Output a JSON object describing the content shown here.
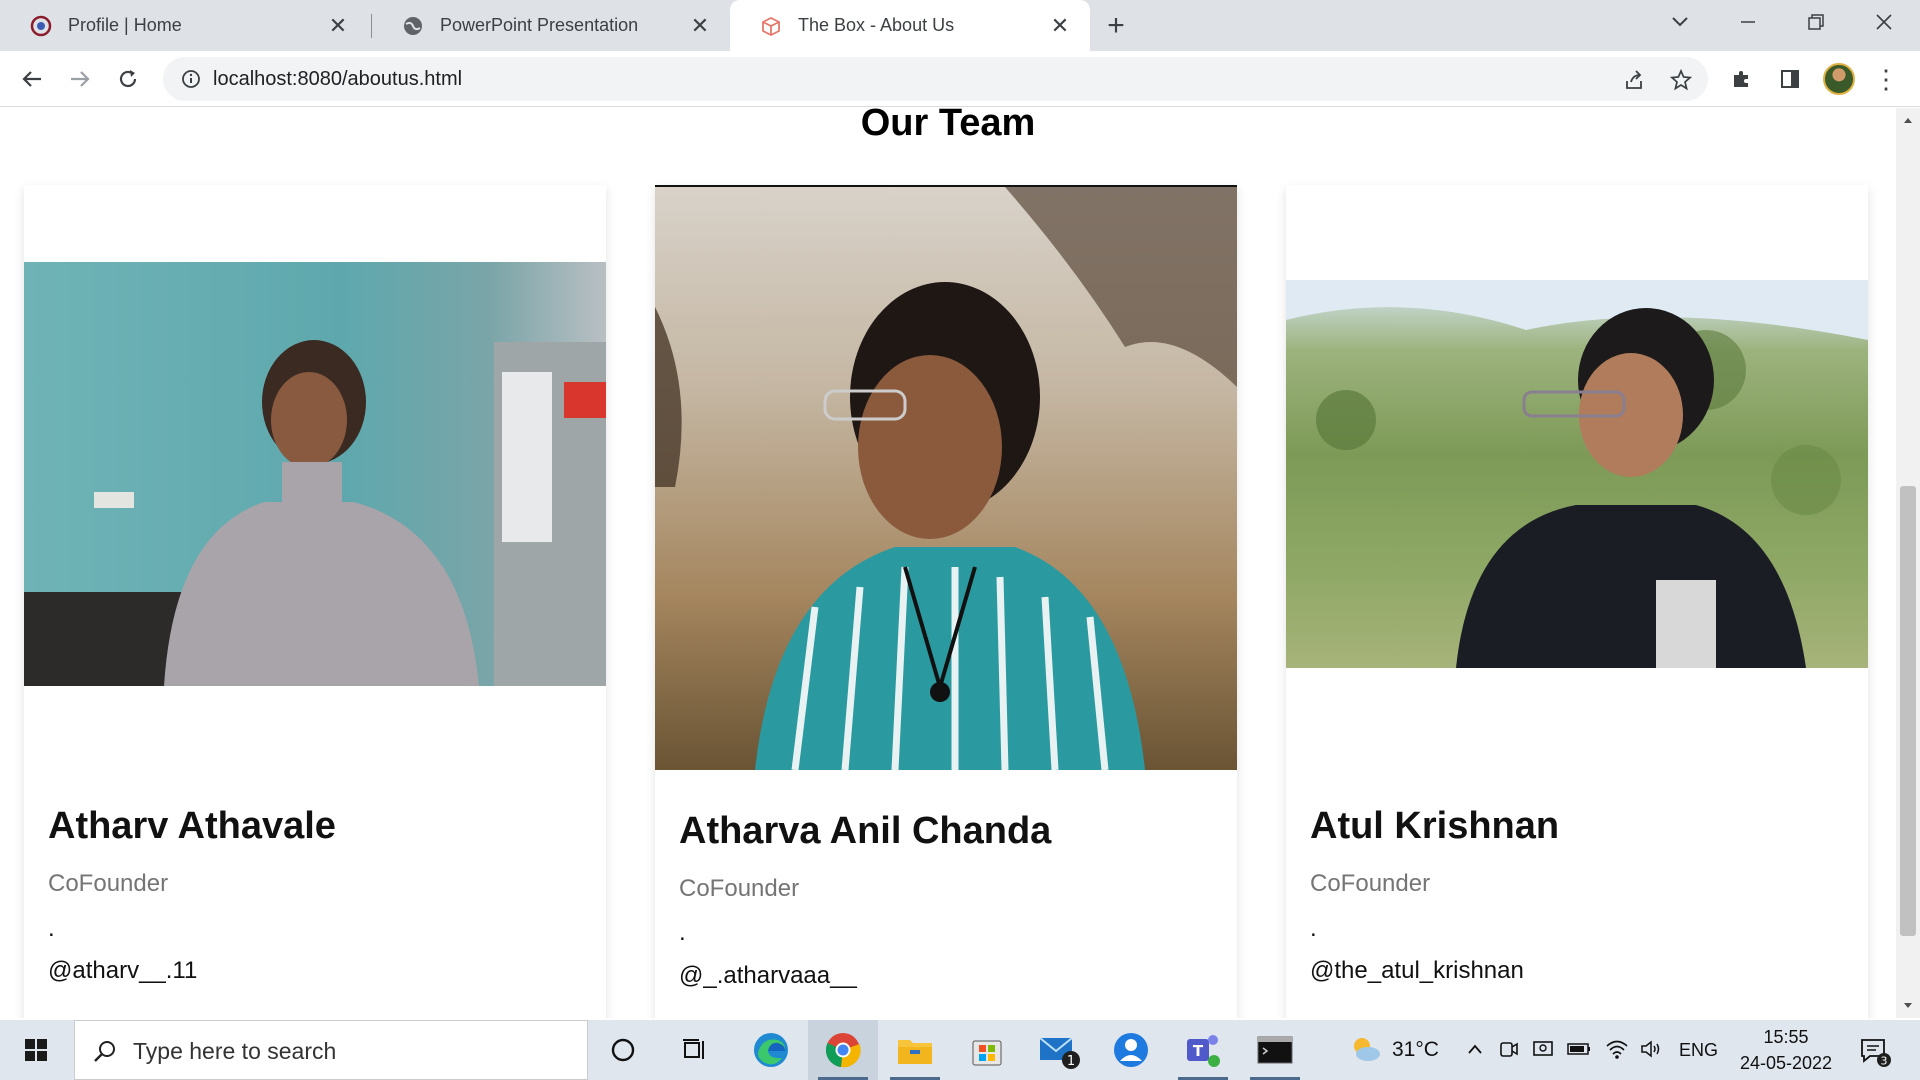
{
  "browser": {
    "tabs": [
      {
        "title": "Profile | Home",
        "icon": "target-icon",
        "active": false
      },
      {
        "title": "PowerPoint Presentation",
        "icon": "globe-icon",
        "active": false
      },
      {
        "title": "The Box - About Us",
        "icon": "box-icon",
        "active": true
      }
    ],
    "url": "localhost:8080/aboutus.html"
  },
  "page": {
    "title": "Our Team",
    "members": [
      {
        "name": "Atharv Athavale",
        "role": "CoFounder",
        "dot": ".",
        "handle": "@atharv__.11"
      },
      {
        "name": "Atharva Anil Chanda",
        "role": "CoFounder",
        "dot": ".",
        "handle": "@_.atharvaaa__"
      },
      {
        "name": "Atul Krishnan",
        "role": "CoFounder",
        "dot": ".",
        "handle": "@the_atul_krishnan"
      }
    ]
  },
  "taskbar": {
    "search_placeholder": "Type here to search",
    "temperature": "31°C",
    "language": "ENG",
    "time": "15:55",
    "date": "24-05-2022",
    "mail_badge": "1",
    "notification_count": "3"
  },
  "colors": {
    "tabbar_bg": "#dee1e6",
    "taskbar_bg": "#dfe6ee",
    "role_text": "#757575"
  }
}
